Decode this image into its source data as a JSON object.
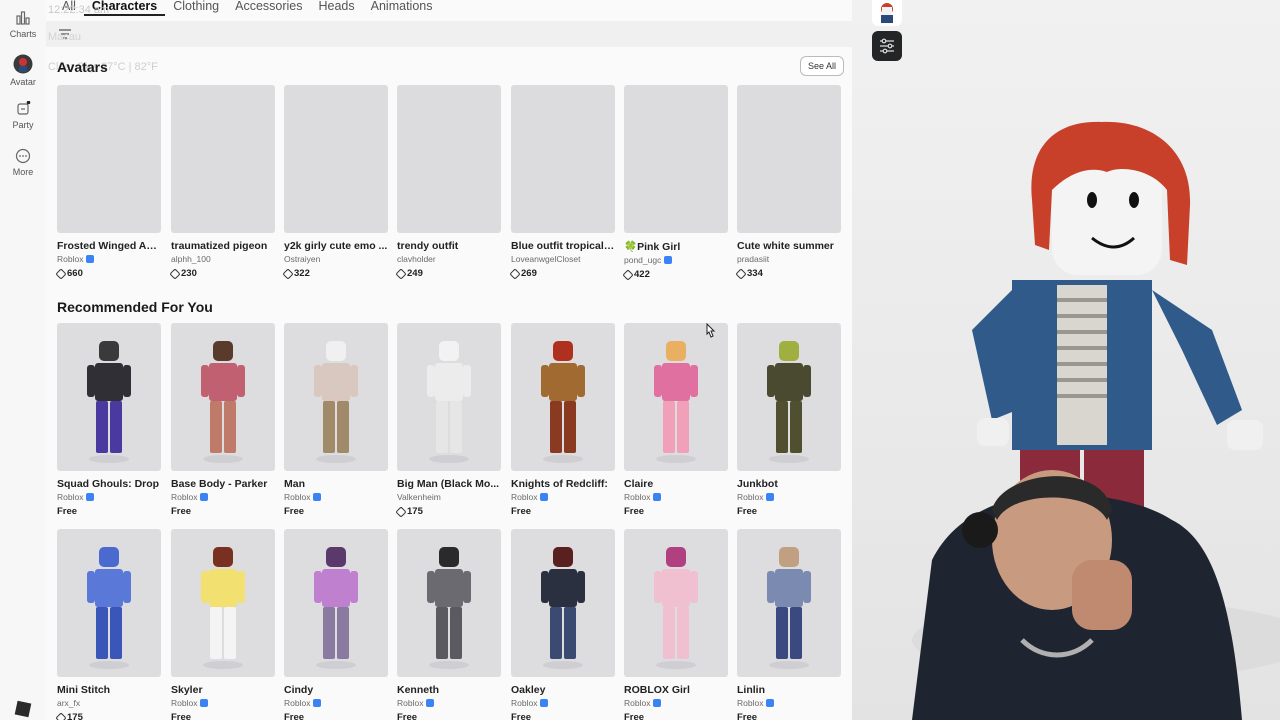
{
  "tabs": [
    {
      "label": "All",
      "active": false
    },
    {
      "label": "Characters",
      "active": true
    },
    {
      "label": "Clothing",
      "active": false
    },
    {
      "label": "Accessories",
      "active": false
    },
    {
      "label": "Heads",
      "active": false
    },
    {
      "label": "Animations",
      "active": false
    }
  ],
  "overlay": {
    "time": "12:22:34 am",
    "city": "Macau",
    "weather": "Clear Sky, 27°C | 82°F"
  },
  "rail": [
    {
      "label": "Charts",
      "icon": "charts-icon"
    },
    {
      "label": "Avatar",
      "icon": "avatar-icon"
    },
    {
      "label": "Party",
      "icon": "party-icon"
    },
    {
      "label": "More",
      "icon": "more-icon"
    }
  ],
  "sections": {
    "avatars": {
      "title": "Avatars",
      "see_all": "See All"
    },
    "recommended": {
      "title": "Recommended For You"
    }
  },
  "avatars": [
    {
      "name": "Frosted Winged An...",
      "creator": "Roblox",
      "verified": true,
      "price": "660",
      "robux": true
    },
    {
      "name": "traumatized pigeon",
      "creator": "alphh_100",
      "verified": false,
      "price": "230",
      "robux": true
    },
    {
      "name": "y2k girly cute emo ...",
      "creator": "Ostraiyen",
      "verified": false,
      "price": "322",
      "robux": true
    },
    {
      "name": "trendy outfit",
      "creator": "clavholder",
      "verified": false,
      "price": "249",
      "robux": true
    },
    {
      "name": "Blue outfit tropical ...",
      "creator": "LoveanwgelCloset",
      "verified": false,
      "price": "269",
      "robux": true
    },
    {
      "name": "🍀Pink Girl",
      "creator": "pond_ugc",
      "verified": true,
      "price": "422",
      "robux": true
    },
    {
      "name": "Cute white summer",
      "creator": "pradasiit",
      "verified": false,
      "price": "334",
      "robux": true
    }
  ],
  "recommended_row1": [
    {
      "name": "Squad Ghouls: Drop",
      "creator": "Roblox",
      "verified": true,
      "price": "Free",
      "robux": false
    },
    {
      "name": "Base Body - Parker",
      "creator": "Roblox",
      "verified": true,
      "price": "Free",
      "robux": false
    },
    {
      "name": "Man",
      "creator": "Roblox",
      "verified": true,
      "price": "Free",
      "robux": false
    },
    {
      "name": "Big Man (Black Mo...",
      "creator": "Valkenheim",
      "verified": false,
      "price": "175",
      "robux": true
    },
    {
      "name": "Knights of Redcliff:",
      "creator": "Roblox",
      "verified": true,
      "price": "Free",
      "robux": false
    },
    {
      "name": "Claire",
      "creator": "Roblox",
      "verified": true,
      "price": "Free",
      "robux": false
    },
    {
      "name": "Junkbot",
      "creator": "Roblox",
      "verified": true,
      "price": "Free",
      "robux": false
    }
  ],
  "recommended_row2": [
    {
      "name": "Mini Stitch",
      "creator": "arx_fx",
      "verified": false,
      "price": "175",
      "robux": true
    },
    {
      "name": "Skyler",
      "creator": "Roblox",
      "verified": true,
      "price": "Free",
      "robux": false
    },
    {
      "name": "Cindy",
      "creator": "Roblox",
      "verified": true,
      "price": "Free",
      "robux": false
    },
    {
      "name": "Kenneth",
      "creator": "Roblox",
      "verified": true,
      "price": "Free",
      "robux": false
    },
    {
      "name": "Oakley",
      "creator": "Roblox",
      "verified": true,
      "price": "Free",
      "robux": false
    },
    {
      "name": "ROBLOX Girl",
      "creator": "Roblox",
      "verified": true,
      "price": "Free",
      "robux": false
    },
    {
      "name": "Linlin",
      "creator": "Roblox",
      "verified": true,
      "price": "Free",
      "robux": false
    }
  ],
  "figure_colors": {
    "row1": [
      {
        "head": "#3a3a3a",
        "body": "#2f2f35",
        "legs": "#4a3aa0"
      },
      {
        "head": "#5a3a2a",
        "body": "#c06070",
        "legs": "#c07a6a"
      },
      {
        "head": "#f0f0f0",
        "body": "#d8c8c0",
        "legs": "#a08a6a"
      },
      {
        "head": "#f2f2f2",
        "body": "#ececec",
        "legs": "#e6e6e6"
      },
      {
        "head": "#b03020",
        "body": "#a06a30",
        "legs": "#8a3a20"
      },
      {
        "head": "#e8b060",
        "body": "#e070a0",
        "legs": "#f0a0b8"
      },
      {
        "head": "#a0b040",
        "body": "#4a4a30",
        "legs": "#505030"
      }
    ],
    "row2": [
      {
        "head": "#4a6ad0",
        "body": "#5a78d8",
        "legs": "#3a56b8"
      },
      {
        "head": "#7a3020",
        "body": "#f2e070",
        "legs": "#f4f4f4"
      },
      {
        "head": "#5a3a6a",
        "body": "#c080d0",
        "legs": "#8a7aa0"
      },
      {
        "head": "#2a2a2a",
        "body": "#6a6a70",
        "legs": "#5a5a60"
      },
      {
        "head": "#5a2020",
        "body": "#2a3040",
        "legs": "#3a4a70"
      },
      {
        "head": "#b04080",
        "body": "#f0c0d0",
        "legs": "#f0c0d0"
      },
      {
        "head": "#c0a080",
        "body": "#7a8ab0",
        "legs": "#3a4a80"
      }
    ]
  }
}
